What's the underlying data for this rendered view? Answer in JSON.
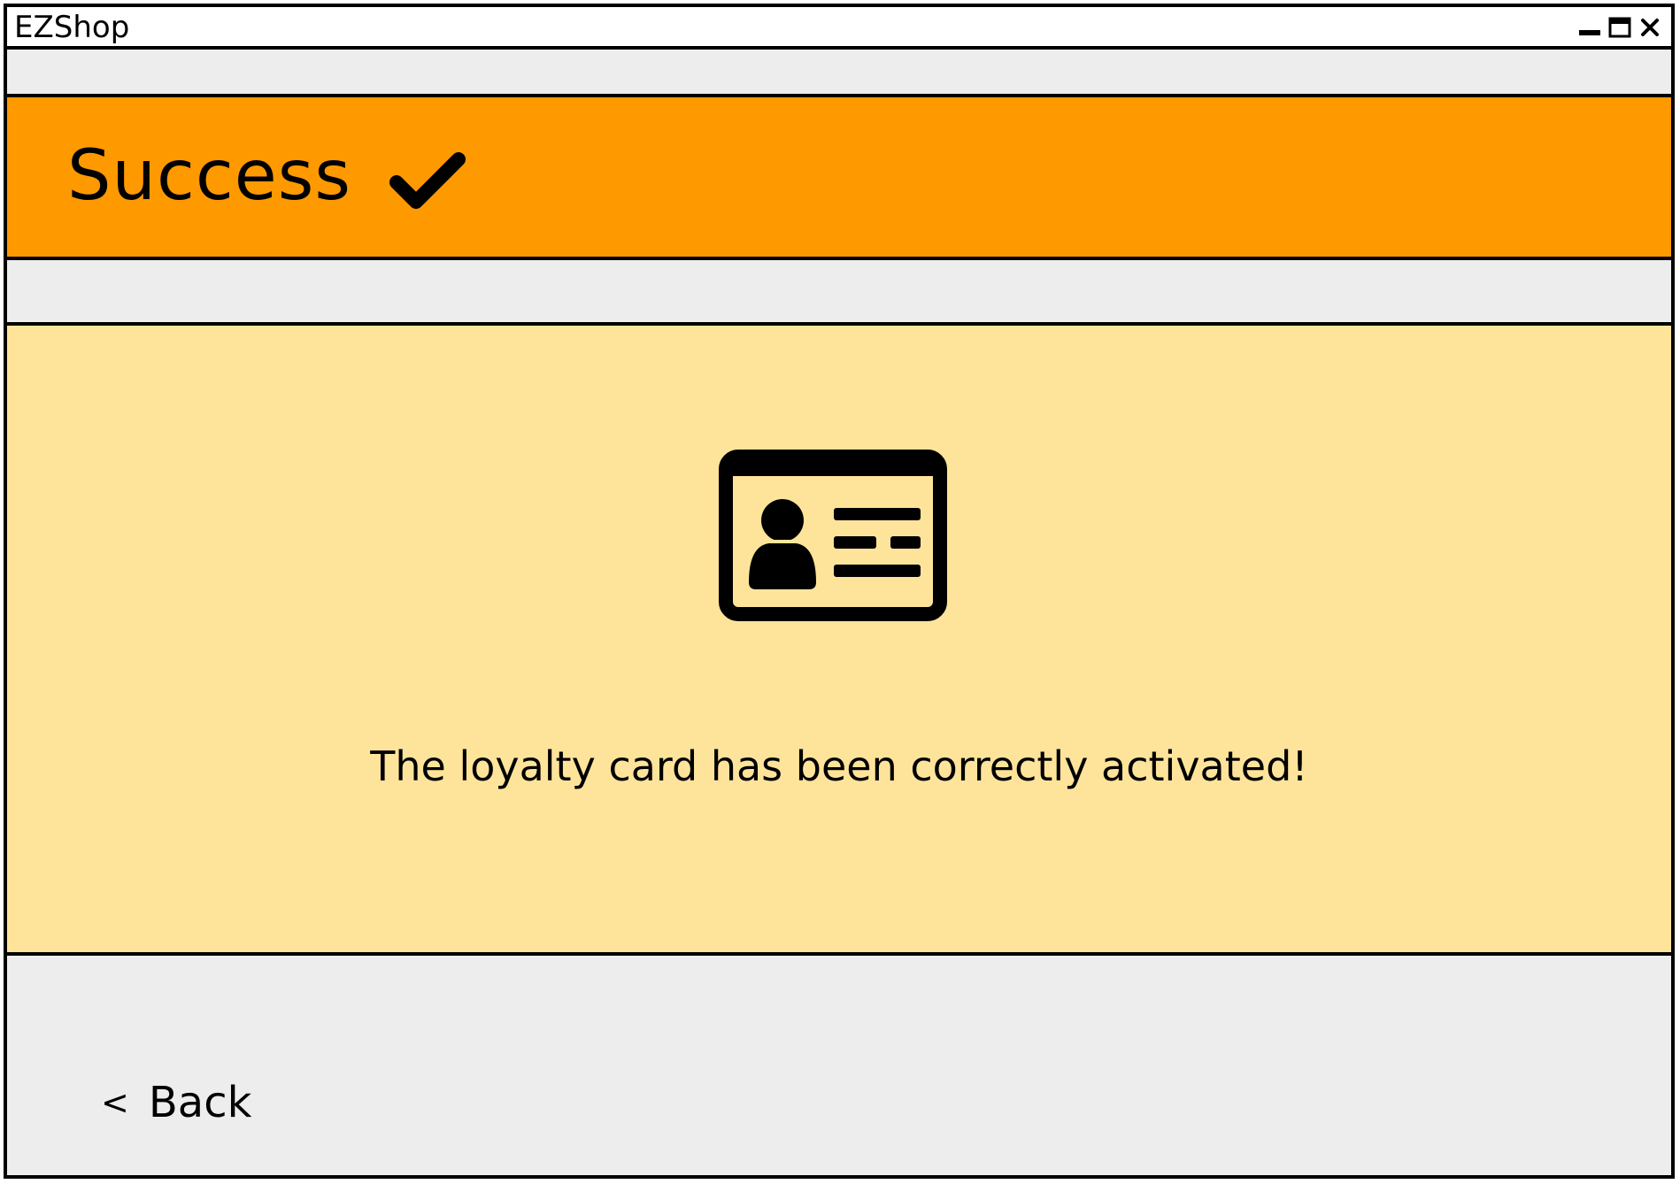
{
  "window": {
    "title": "EZShop",
    "controls": {
      "minimize": "minimize-icon",
      "maximize": "maximize-icon",
      "close": "close-icon"
    }
  },
  "header": {
    "title": "Success",
    "icon": "checkmark-icon",
    "background": "#ff9900"
  },
  "content": {
    "icon": "id-card-icon",
    "message": "The loyalty card has been correctly activated!",
    "background": "#fee49a"
  },
  "footer": {
    "back_chevron": "<",
    "back_label": "Back"
  },
  "colors": {
    "window_bg": "#ededed",
    "border": "#000000"
  }
}
